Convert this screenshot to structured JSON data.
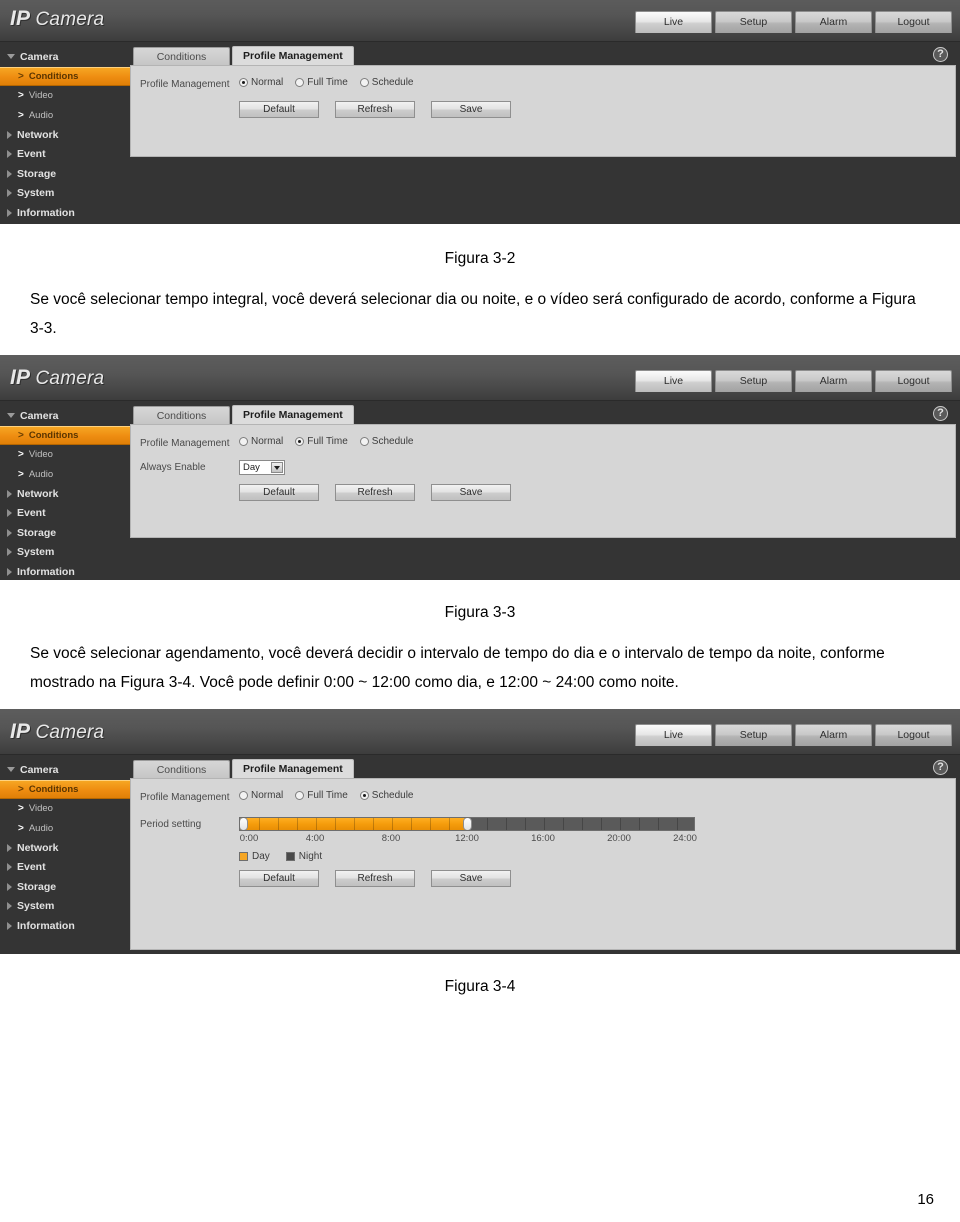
{
  "page_number": "16",
  "app": {
    "logo_bold": "IP",
    "logo_thin": "Camera",
    "nav_buttons": [
      {
        "label": "Live",
        "state": "active"
      },
      {
        "label": "Setup",
        "state": "inactive"
      },
      {
        "label": "Alarm",
        "state": "inactive"
      },
      {
        "label": "Logout",
        "state": "inactive"
      }
    ],
    "help_icon_label": "?",
    "sidebar": [
      {
        "label": "Camera",
        "type": "group",
        "icon": "caret-down-icon"
      },
      {
        "label": "Conditions",
        "type": "sub",
        "icon": "chevron-right-icon",
        "active": true
      },
      {
        "label": "Video",
        "type": "sub",
        "icon": "chevron-right-icon",
        "active": false
      },
      {
        "label": "Audio",
        "type": "sub",
        "icon": "chevron-right-icon",
        "active": false
      },
      {
        "label": "Network",
        "type": "group",
        "icon": "caret-right-icon"
      },
      {
        "label": "Event",
        "type": "group",
        "icon": "caret-right-icon"
      },
      {
        "label": "Storage",
        "type": "group",
        "icon": "caret-right-icon"
      },
      {
        "label": "System",
        "type": "group",
        "icon": "caret-right-icon"
      },
      {
        "label": "Information",
        "type": "group",
        "icon": "caret-right-icon"
      }
    ],
    "tabs": [
      {
        "label": "Conditions",
        "active": false
      },
      {
        "label": "Profile Management",
        "active": true
      }
    ],
    "form": {
      "profile_management_label": "Profile Management",
      "always_enable_label": "Always Enable",
      "period_setting_label": "Period setting",
      "radio_options": [
        "Normal",
        "Full Time",
        "Schedule"
      ],
      "always_enable_value": "Day",
      "legend": [
        "Day",
        "Night"
      ]
    },
    "buttons": [
      "Default",
      "Refresh",
      "Save"
    ],
    "timeline": {
      "tick_labels": [
        "0:00",
        "4:00",
        "8:00",
        "12:00",
        "16:00",
        "20:00",
        "24:00"
      ],
      "day_end_hour": 12,
      "total_hours": 24
    },
    "colors": {
      "accent": "#f6a623",
      "header": "#565656",
      "sidebar": "#343434",
      "panel": "#d6d6d6",
      "night": "#4a4a4a"
    }
  },
  "figures": {
    "fig32_caption": "Figura 3-2",
    "fig33_caption": "Figura 3-3",
    "fig34_caption": "Figura 3-4"
  },
  "paragraphs": {
    "p1": "Se você selecionar tempo integral, você deverá selecionar dia ou noite, e o vídeo será configurado de acordo, conforme a Figura 3-3.",
    "p2": "Se você selecionar agendamento, você deverá decidir o intervalo de tempo do dia e o intervalo de tempo da noite, conforme mostrado na Figura 3-4. Você pode definir 0:00 ~ 12:00 como dia, e 12:00 ~ 24:00 como noite."
  },
  "panel_states": {
    "panel1_selected_radio": "Normal",
    "panel2_selected_radio": "Full Time",
    "panel3_selected_radio": "Schedule"
  }
}
